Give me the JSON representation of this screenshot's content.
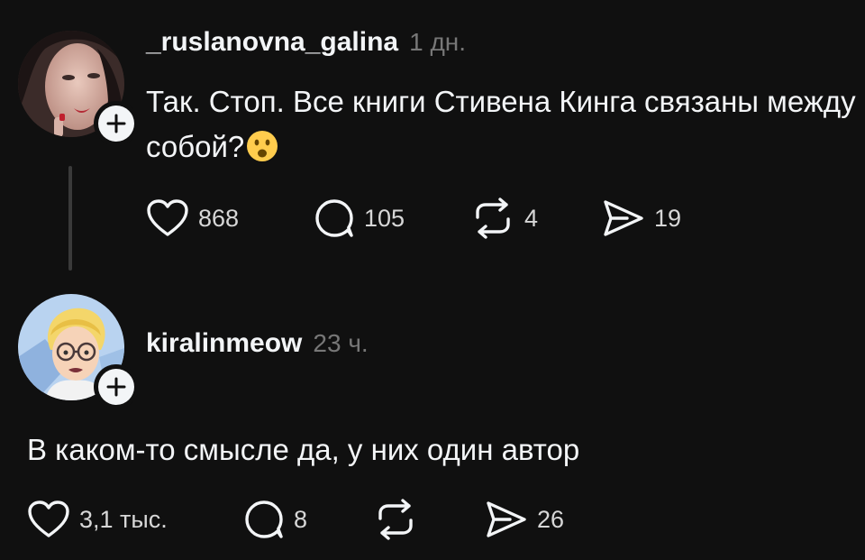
{
  "posts": [
    {
      "username": "_ruslanovna_galina",
      "timestamp": "1 дн.",
      "text": "Так. Стоп. Все книги Стивена Кинга связаны между собой?",
      "emoji": "😦",
      "likes": "868",
      "comments": "105",
      "reposts": "4",
      "shares": "19",
      "icons": [
        "heart-icon",
        "comment-icon",
        "repost-icon",
        "share-icon",
        "plus-icon"
      ]
    },
    {
      "username": "kiralinmeow",
      "timestamp": "23 ч.",
      "text": "В каком-то смысле да, у них один автор",
      "likes": "3,1 тыс.",
      "comments": "8",
      "reposts": "",
      "shares": "26",
      "icons": [
        "heart-icon",
        "comment-icon",
        "repost-icon",
        "share-icon",
        "plus-icon"
      ]
    }
  ],
  "colors": {
    "background": "#101010",
    "text": "#f3f5f7",
    "secondary": "#777777",
    "thread_line": "#3a3a3a"
  }
}
